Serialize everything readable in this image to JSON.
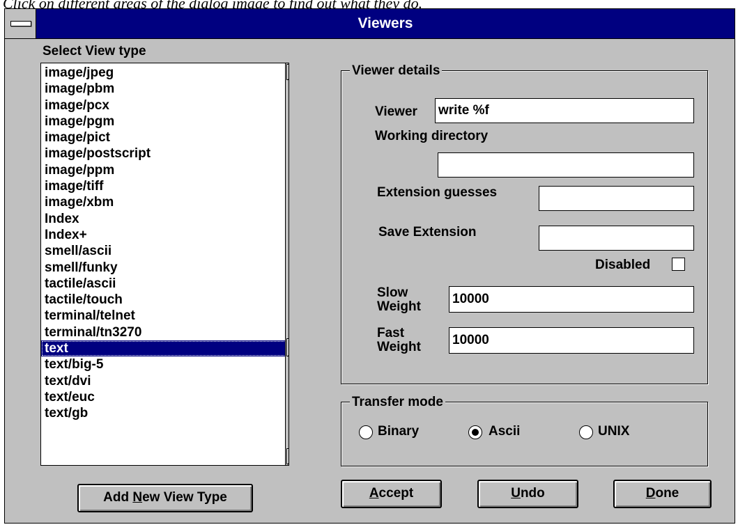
{
  "caption": "Click on different areas of the dialog image to find out what they do.",
  "window": {
    "title": "Viewers"
  },
  "list": {
    "label": "Select View type",
    "items": [
      "image/jpeg",
      "image/pbm",
      "image/pcx",
      "image/pgm",
      "image/pict",
      "image/postscript",
      "image/ppm",
      "image/tiff",
      "image/xbm",
      "Index",
      "Index+",
      "smell/ascii",
      "smell/funky",
      "tactile/ascii",
      "tactile/touch",
      "terminal/telnet",
      "terminal/tn3270",
      "text",
      "text/big-5",
      "text/dvi",
      "text/euc",
      "text/gb"
    ],
    "selected": "text"
  },
  "details": {
    "legend": "Viewer details",
    "viewer_label": "Viewer",
    "viewer_value": "write %f",
    "workdir_label": "Working directory",
    "workdir_value": "",
    "ext_guess_label": "Extension guesses",
    "ext_guess_value": "",
    "save_ext_label": "Save Extension",
    "save_ext_value": "",
    "disabled_label": "Disabled",
    "disabled_checked": false,
    "slow_label_1": "Slow",
    "slow_label_2": "Weight",
    "slow_value": "10000",
    "fast_label_1": "Fast",
    "fast_label_2": "Weight",
    "fast_value": "10000"
  },
  "transfer": {
    "legend": "Transfer mode",
    "options": [
      "Binary",
      "Ascii",
      "UNIX"
    ],
    "selected": "Ascii"
  },
  "buttons": {
    "add_pre": "Add ",
    "add_key": "N",
    "add_post": "ew View Type",
    "accept_key": "A",
    "accept_post": "ccept",
    "undo_key": "U",
    "undo_post": "ndo",
    "done_key": "D",
    "done_post": "one"
  }
}
